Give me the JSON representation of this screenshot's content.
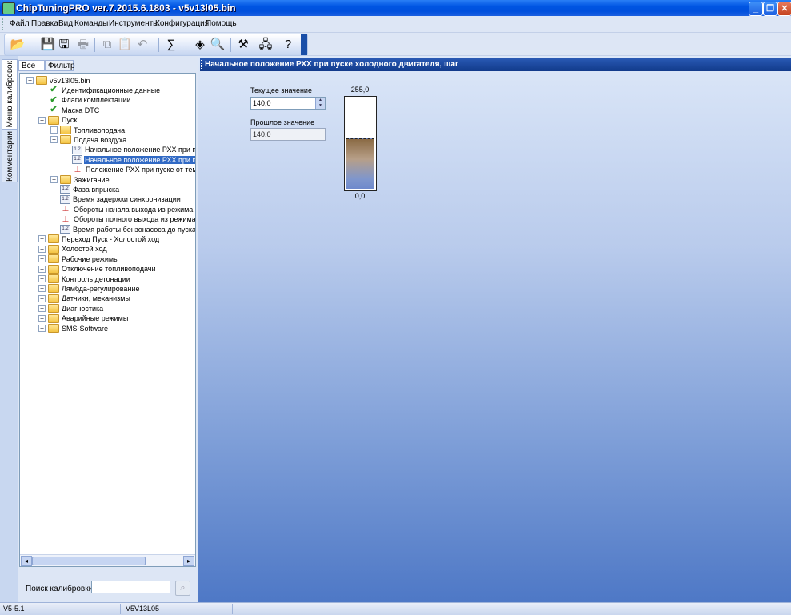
{
  "window": {
    "title": "ChipTuningPRO ver.7.2015.6.1803 - v5v13l05.bin",
    "buttons": {
      "minimize": "_",
      "maximize": "❐",
      "close": "✕"
    }
  },
  "menu": [
    "Файл",
    "Правка",
    "Вид",
    "Команды",
    "Инструменты",
    "Конфигурация",
    "Помощь"
  ],
  "toolbar": {
    "buttons": [
      {
        "icon": "open-folder-icon",
        "glyph": "📂",
        "enabled": true
      },
      {
        "icon": "save-icon",
        "glyph": "💾",
        "enabled": true
      },
      {
        "icon": "save-as-icon",
        "glyph": "🖫",
        "enabled": true
      },
      {
        "icon": "print-icon",
        "glyph": "🖶",
        "enabled": false
      },
      {
        "icon": "copy-icon",
        "glyph": "⧉",
        "enabled": false
      },
      {
        "icon": "paste-icon",
        "glyph": "📋",
        "enabled": false
      },
      {
        "icon": "undo-icon",
        "glyph": "↶",
        "enabled": false
      },
      {
        "icon": "checksum-icon",
        "glyph": "∑",
        "enabled": true
      },
      {
        "icon": "diamond-icon",
        "glyph": "◈",
        "enabled": true
      },
      {
        "icon": "search-zoom-icon",
        "glyph": "🔍",
        "enabled": true
      },
      {
        "icon": "tools-icon",
        "glyph": "⚒",
        "enabled": true
      },
      {
        "icon": "network-icon",
        "glyph": "🖧",
        "enabled": true
      },
      {
        "icon": "help-icon",
        "glyph": "?",
        "enabled": true
      }
    ]
  },
  "side_tabs": [
    "Меню калибровок",
    "Комментарии"
  ],
  "panel_tabs": [
    "Все",
    "Фильтр"
  ],
  "tree": [
    {
      "text": "v5v13l05.bin",
      "icon": "folder",
      "level": 0,
      "exp": "−"
    },
    {
      "text": "Идентификационные данные",
      "icon": "check",
      "level": 1,
      "exp": ""
    },
    {
      "text": "Флаги комплектации",
      "icon": "check",
      "level": 1,
      "exp": ""
    },
    {
      "text": "Маска DTC",
      "icon": "check",
      "level": 1,
      "exp": ""
    },
    {
      "text": "Пуск",
      "icon": "folder",
      "level": 1,
      "exp": "−"
    },
    {
      "text": "Топливоподача",
      "icon": "folder",
      "level": 2,
      "exp": "+"
    },
    {
      "text": "Подача воздуха",
      "icon": "folder",
      "level": 2,
      "exp": "−"
    },
    {
      "text": "Начальное положение РХХ при пуск",
      "icon": "num",
      "level": 3,
      "exp": ""
    },
    {
      "text": "Начальное положение РХХ при пус",
      "icon": "num",
      "level": 3,
      "exp": "",
      "selected": true
    },
    {
      "text": "Положение РХХ при пуске от темпе",
      "icon": "graph",
      "level": 3,
      "exp": ""
    },
    {
      "text": "Зажигание",
      "icon": "folder",
      "level": 2,
      "exp": "+"
    },
    {
      "text": "Фаза впрыска",
      "icon": "num",
      "level": 2,
      "exp": ""
    },
    {
      "text": "Время задержки синхронизации",
      "icon": "num",
      "level": 2,
      "exp": ""
    },
    {
      "text": "Обороты начала выхода из режима пу",
      "icon": "graph",
      "level": 2,
      "exp": ""
    },
    {
      "text": "Обороты полного выхода из режима п",
      "icon": "graph",
      "level": 2,
      "exp": ""
    },
    {
      "text": "Время работы бензонасоса до пуска",
      "icon": "num",
      "level": 2,
      "exp": ""
    },
    {
      "text": "Переход Пуск - Холостой ход",
      "icon": "folder",
      "level": 1,
      "exp": "+"
    },
    {
      "text": "Холостой ход",
      "icon": "folder",
      "level": 1,
      "exp": "+"
    },
    {
      "text": "Рабочие режимы",
      "icon": "folder",
      "level": 1,
      "exp": "+"
    },
    {
      "text": "Отключение топливоподачи",
      "icon": "folder",
      "level": 1,
      "exp": "+"
    },
    {
      "text": "Контроль детонации",
      "icon": "folder",
      "level": 1,
      "exp": "+"
    },
    {
      "text": "Лямбда-регулирование",
      "icon": "folder",
      "level": 1,
      "exp": "+"
    },
    {
      "text": "Датчики, механизмы",
      "icon": "folder",
      "level": 1,
      "exp": "+"
    },
    {
      "text": "Диагностика",
      "icon": "folder",
      "level": 1,
      "exp": "+"
    },
    {
      "text": "Аварийные режимы",
      "icon": "folder",
      "level": 1,
      "exp": "+"
    },
    {
      "text": "SMS-Software",
      "icon": "folder",
      "level": 1,
      "exp": "+"
    }
  ],
  "search": {
    "label": "Поиск калибровки",
    "value": ""
  },
  "editor": {
    "title": "Начальное положение РХХ при пуске холодного двигателя, шаг",
    "current_label": "Текущее значение",
    "current_value": "140,0",
    "previous_label": "Прошлое значение",
    "previous_value": "140,0",
    "gauge": {
      "max_label": "255,0",
      "min_label": "0,0",
      "max": 255,
      "min": 0,
      "value": 140
    }
  },
  "status": [
    "V5-5.1",
    "V5V13L05"
  ]
}
